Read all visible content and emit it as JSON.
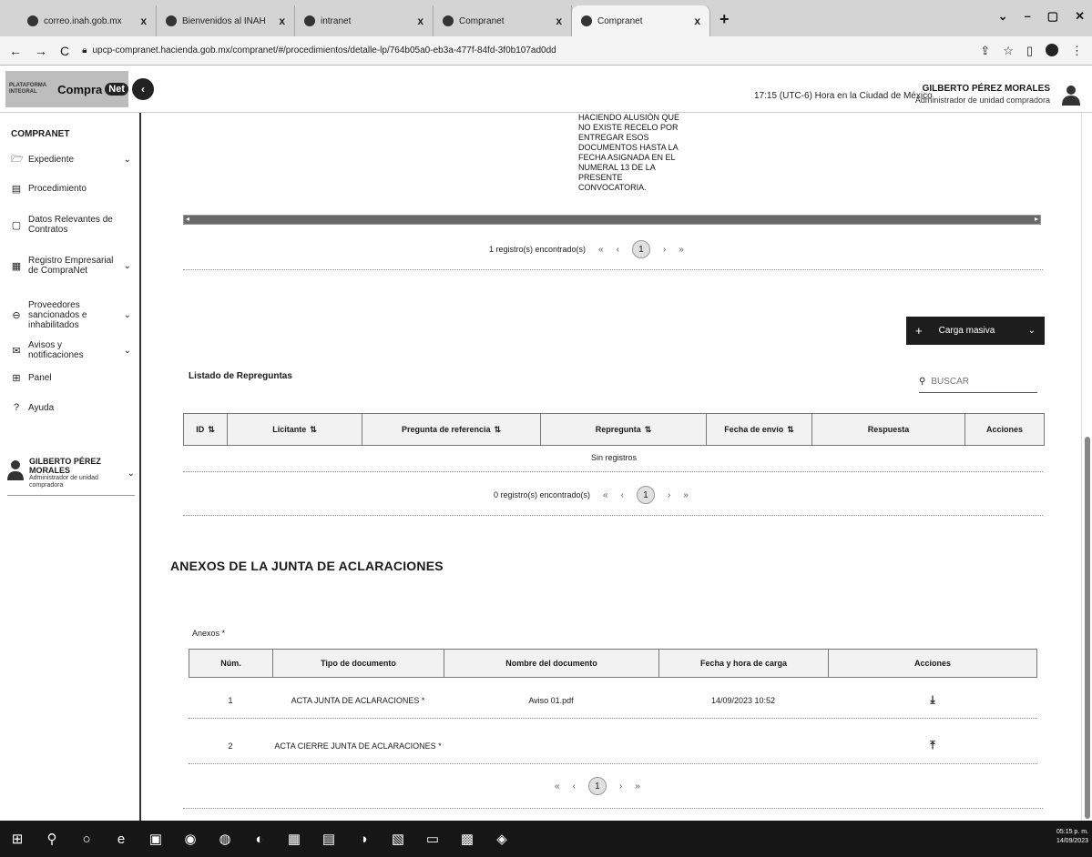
{
  "browser": {
    "tabs": [
      {
        "label": "correo.inah.gob.mx",
        "active": false
      },
      {
        "label": "Bienvenidos al INAH",
        "active": false
      },
      {
        "label": "intranet",
        "active": false
      },
      {
        "label": "Compranet",
        "active": false
      },
      {
        "label": "Compranet",
        "active": true
      }
    ],
    "tab_close": "x",
    "new_tab": "+",
    "url": "upcp-compranet.hacienda.gob.mx/compranet/#/procedimientos/detalle-lp/764b05a0-eb3a-477f-84fd-3f0b107ad0dd",
    "window_controls": [
      "⌄",
      "–",
      "▢",
      "✕"
    ]
  },
  "header": {
    "logo_small": "PLATAFORMA INTEGRAL",
    "logo_main": "Compra",
    "logo_net": "Net",
    "clock": "17:15 (UTC-6) Hora en la Ciudad de México",
    "user_name": "GILBERTO PÉREZ MORALES",
    "user_role": "Administrador de unidad compradora"
  },
  "sidebar": {
    "title": "COMPRANET",
    "items": [
      {
        "label": "Expediente",
        "icon": "folder-icon",
        "chevron": true
      },
      {
        "label": "Procedimiento",
        "icon": "document-icon",
        "chevron": false
      },
      {
        "label": "Datos Relevantes de Contratos",
        "icon": "bookmark-icon",
        "chevron": false
      },
      {
        "label": "Registro Empresarial de CompraNet",
        "icon": "building-icon",
        "chevron": true
      },
      {
        "label": "Proveedores sancionados e inhabilitados",
        "icon": "ban-icon",
        "chevron": true
      },
      {
        "label": "Avisos y notificaciones",
        "icon": "mail-icon",
        "chevron": true
      },
      {
        "label": "Panel",
        "icon": "grid-icon",
        "chevron": false
      },
      {
        "label": "Ayuda",
        "icon": "help-icon",
        "chevron": false
      }
    ],
    "user_name": "GILBERTO PÉREZ MORALES",
    "user_role": "Administrador de unidad compradora"
  },
  "main": {
    "wrap_text": [
      "HACIENDO ALUSIÓN QUE",
      "NO EXISTE RECELO POR",
      "ENTREGAR ESOS",
      "DOCUMENTOS HASTA LA",
      "FECHA ASIGNADA EN EL",
      "NUMERAL 13 DE LA",
      "PRESENTE",
      "CONVOCATORIA."
    ],
    "pager1": {
      "text": "1 registro(s) encontrado(s)",
      "first": "«",
      "prev": "‹",
      "current": "1",
      "next": "›",
      "last": "»"
    },
    "carga_masiva": "Carga masiva",
    "repreguntas": {
      "title": "Listado de Repreguntas",
      "search_placeholder": "BUSCAR",
      "columns": [
        {
          "label": "ID",
          "sort": true
        },
        {
          "label": "Licitante",
          "sort": true
        },
        {
          "label": "Pregunta de referencia",
          "sort": true
        },
        {
          "label": "Repregunta",
          "sort": true
        },
        {
          "label": "Fecha de envío",
          "sort": true
        },
        {
          "label": "Respuesta",
          "sort": false
        },
        {
          "label": "Acciones",
          "sort": false
        }
      ],
      "empty": "Sin registros",
      "pager": {
        "text": "0 registro(s) encontrado(s)",
        "first": "«",
        "prev": "‹",
        "current": "1",
        "next": "›",
        "last": "»"
      }
    },
    "anexos": {
      "title": "ANEXOS DE LA JUNTA DE ACLARACIONES",
      "label": "Anexos *",
      "columns": [
        "Núm.",
        "Tipo de documento",
        "Nombre del documento",
        "Fecha y hora de carga",
        "Acciones"
      ],
      "rows": [
        {
          "num": "1",
          "tipo": "ACTA JUNTA DE ACLARACIONES *",
          "nombre": "Aviso 01.pdf",
          "fecha": "14/09/2023 10:52",
          "action": "download-icon"
        },
        {
          "num": "2",
          "tipo": "ACTA CIERRE JUNTA DE ACLARACIONES *",
          "nombre": "",
          "fecha": "",
          "action": "upload-icon"
        }
      ],
      "pager": {
        "first": "«",
        "prev": "‹",
        "current": "1",
        "next": "›",
        "last": "»"
      }
    }
  },
  "taskbar": {
    "time": "05:15 p. m.",
    "date": "14/09/2023"
  }
}
